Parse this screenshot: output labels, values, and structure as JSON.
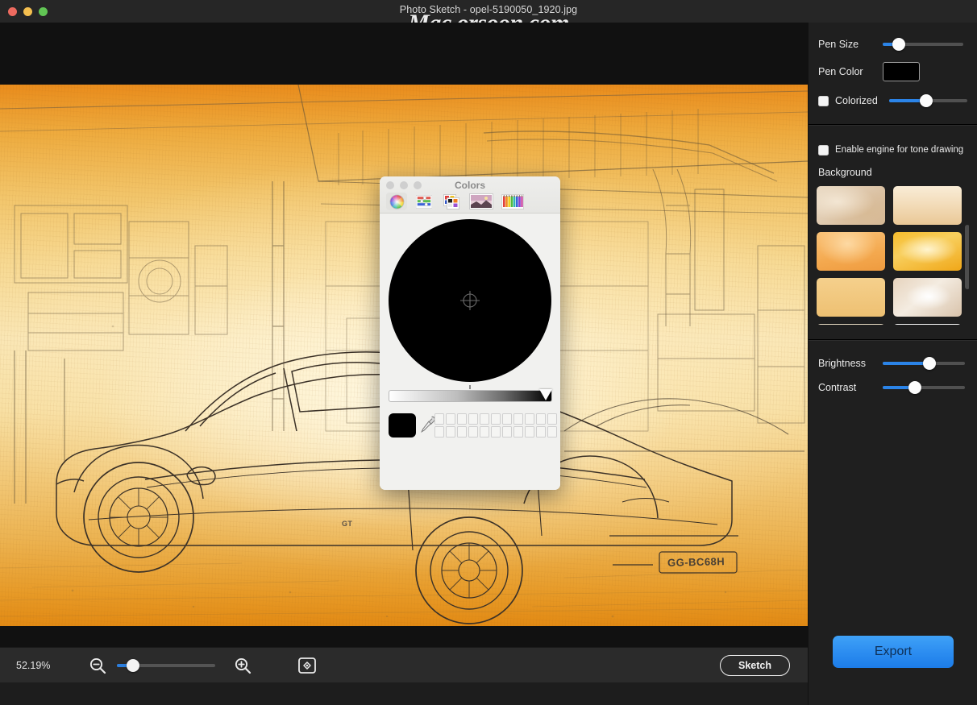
{
  "window": {
    "title": "Photo Sketch - opel-5190050_1920.jpg",
    "watermark": "Mac.orsoon.com",
    "traffic_lights": [
      "close-button",
      "minimize-button",
      "zoom-button"
    ],
    "colors": {
      "titlebar_bg": "#262626",
      "sidebar_bg": "#1f1f1f",
      "accent_blue": "#2b84e8",
      "canvas_bg": "#111111"
    }
  },
  "canvas": {
    "image_name": "opel-5190050_1920.jpg",
    "description": "Pencil sketch rendering of a classic Opel GT coupe parked in a garage, drawn on amber/orange textured paper",
    "license_plate": "GG-BC68H",
    "car_badge": "GT"
  },
  "sidebar": {
    "pen": {
      "size_label": "Pen Size",
      "size_value": 18,
      "color_label": "Pen Color",
      "color_value": "#000000"
    },
    "colorized": {
      "label": "Colorized",
      "checked": false,
      "value": 42
    },
    "tone": {
      "label": "Enable engine for tone drawing",
      "checked": false
    },
    "background": {
      "label": "Background",
      "thumbnails": [
        {
          "name": "paper-marble-beige",
          "color1": "#e8d8c2",
          "color2": "#d9bd9b"
        },
        {
          "name": "paper-cream-tan",
          "color1": "#f6e2c4",
          "color2": "#ecc89b"
        },
        {
          "name": "paper-orange-wash",
          "color1": "#f8b96a",
          "color2": "#f0a050"
        },
        {
          "name": "paper-golden-glow",
          "color1": "#fde6a4",
          "color2": "#f2a92a"
        },
        {
          "name": "paper-flat-amber",
          "color1": "#f4cd86",
          "color2": "#f0c274"
        },
        {
          "name": "paper-light-burst",
          "color1": "#fdf6ee",
          "color2": "#ddc7b1"
        },
        {
          "name": "paper-pale-sand",
          "color1": "#e6d8bf",
          "color2": "#d5c29f"
        },
        {
          "name": "paper-white-linen",
          "color1": "#fafafa",
          "color2": "#eaeaea"
        }
      ]
    },
    "brightness": {
      "label": "Brightness",
      "value": 52
    },
    "contrast": {
      "label": "Contrast",
      "value": 34
    },
    "export": {
      "label": "Export"
    }
  },
  "bottom_bar": {
    "zoom_percent": "52.19%",
    "zoom_out_icon": "magnifier-minus-icon",
    "zoom_in_icon": "magnifier-plus-icon",
    "fit_icon": "fit-to-screen-icon",
    "zoom_slider_value": 12,
    "sketch_label": "Sketch"
  },
  "colors_dialog": {
    "title": "Colors",
    "traffic_lights": [
      "close-button",
      "minimize-button",
      "zoom-button"
    ],
    "tabs": [
      {
        "name": "color-wheel-tab",
        "label": "Color Wheel",
        "selected": true
      },
      {
        "name": "color-sliders-tab",
        "label": "Color Sliders",
        "selected": false
      },
      {
        "name": "color-palettes-tab",
        "label": "Color Palettes",
        "selected": false
      },
      {
        "name": "image-palettes-tab",
        "label": "Image Palettes",
        "selected": false
      },
      {
        "name": "pencils-tab",
        "label": "Pencils",
        "selected": false
      }
    ],
    "wheel": {
      "selected_color": "#000000",
      "brightness": 0,
      "crosshair_position": "center"
    },
    "brightness_slider": {
      "from": "#ffffff",
      "to": "#000000",
      "handle_position": "right"
    },
    "current_color": "#000000",
    "eyedropper_icon": "eyedropper-icon",
    "swatch_rows": 2,
    "swatch_cols": 11
  }
}
